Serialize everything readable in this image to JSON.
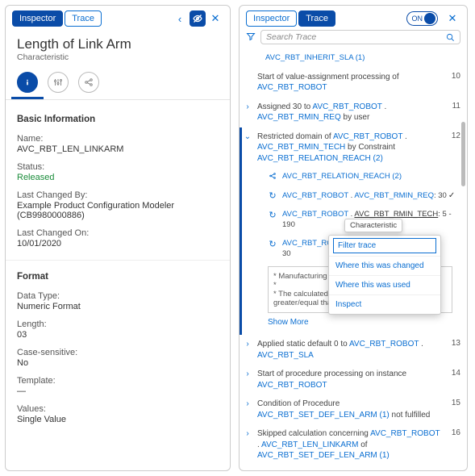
{
  "left": {
    "tabs": {
      "inspector": "Inspector",
      "trace": "Trace"
    },
    "title": "Length of Link Arm",
    "subtitle": "Characteristic",
    "icons": {
      "info": "info-icon",
      "sliders": "sliders-icon",
      "share": "share-icon"
    },
    "sections": {
      "basic": "Basic Information",
      "format": "Format"
    },
    "fields": {
      "name_l": "Name:",
      "name_v": "AVC_RBT_LEN_LINKARM",
      "status_l": "Status:",
      "status_v": "Released",
      "changedby_l": "Last Changed By:",
      "changedby_v": "Example Product Configuration Modeler (CB9980000886)",
      "changedon_l": "Last Changed On:",
      "changedon_v": "10/01/2020",
      "datatype_l": "Data Type:",
      "datatype_v": "Numeric Format",
      "length_l": "Length:",
      "length_v": "03",
      "case_l": "Case-sensitive:",
      "case_v": "No",
      "template_l": "Template:",
      "template_v": "—",
      "values_l": "Values:",
      "values_v": "Single Value"
    }
  },
  "right": {
    "tabs": {
      "inspector": "Inspector",
      "trace": "Trace"
    },
    "toggle": "ON",
    "search_placeholder": "Search Trace",
    "rows": [
      {
        "type": "sub",
        "icon": "",
        "text": "AVC_RBT_INHERIT_SLA (1)",
        "num": ""
      },
      {
        "type": "row",
        "chev": "",
        "pre": "Start of value-assignment processing of ",
        "link": "AVC_RBT_ROBOT",
        "post": "",
        "num": "10"
      },
      {
        "type": "row",
        "chev": "›",
        "pre": "Assigned 30 to ",
        "link": "AVC_RBT_ROBOT",
        "mid": " . ",
        "link2": "AVC_RBT_RMIN_REQ",
        "post": " by user",
        "num": "11"
      },
      {
        "type": "row",
        "chev": "⌄",
        "pre": "Restricted domain of ",
        "link": "AVC_RBT_ROBOT",
        "mid": " . ",
        "link2": "AVC_RBT_RMIN_TECH",
        "post": " by Constraint ",
        "link3": "AVC_RBT_RELATION_REACH (2)",
        "num": "12"
      },
      {
        "type": "sub",
        "icon": "share",
        "link": "AVC_RBT_RELATION_REACH (2)"
      },
      {
        "type": "sub",
        "icon": "reload",
        "link": "AVC_RBT_ROBOT",
        "mid": " . ",
        "link2": "AVC_RBT_RMIN_REQ",
        "post": ": 30",
        "check": true
      },
      {
        "type": "sub",
        "icon": "reload",
        "link": "AVC_RBT_ROBOT",
        "mid": " . ",
        "underline": "AVC_RBT_RMIN_TECH",
        "post": ": 5 - 190"
      },
      {
        "type": "sub",
        "icon": "reload",
        "link": "AVC_RBT_ROBOT",
        "post2": "30"
      },
      {
        "type": "block",
        "l1": "* Manufacturing depe",
        "l2": "*",
        "l3": "* The calculated max",
        "l4": "greater/equal than"
      },
      {
        "type": "showmore",
        "text": "Show More"
      },
      {
        "type": "row",
        "chev": "›",
        "pre": "Applied static default 0 to ",
        "link": "AVC_RBT_ROBOT",
        "mid": " . ",
        "link2": "AVC_RBT_SLA",
        "num": "13"
      },
      {
        "type": "row",
        "chev": "›",
        "pre": "Start of procedure processing on instance ",
        "link": "AVC_RBT_ROBOT",
        "num": "14"
      },
      {
        "type": "row",
        "chev": "›",
        "pre": "Condition of Procedure ",
        "link": "AVC_RBT_SET_DEF_LEN_ARM (1)",
        "post": " not fulfilled",
        "num": "15"
      },
      {
        "type": "row",
        "chev": "›",
        "pre": "Skipped calculation concerning ",
        "link": "AVC_RBT_ROBOT",
        "mid": " . ",
        "link2": "AVC_RBT_LEN_LINKARM",
        "post": " of ",
        "link3": "AVC_RBT_SET_DEF_LEN_ARM (1)",
        "num": "16"
      }
    ],
    "tooltip": "Characteristic",
    "popup": {
      "item1": "Filter trace",
      "item2": "Where this was changed",
      "item3": "Where this was used",
      "item4": "Inspect"
    }
  }
}
